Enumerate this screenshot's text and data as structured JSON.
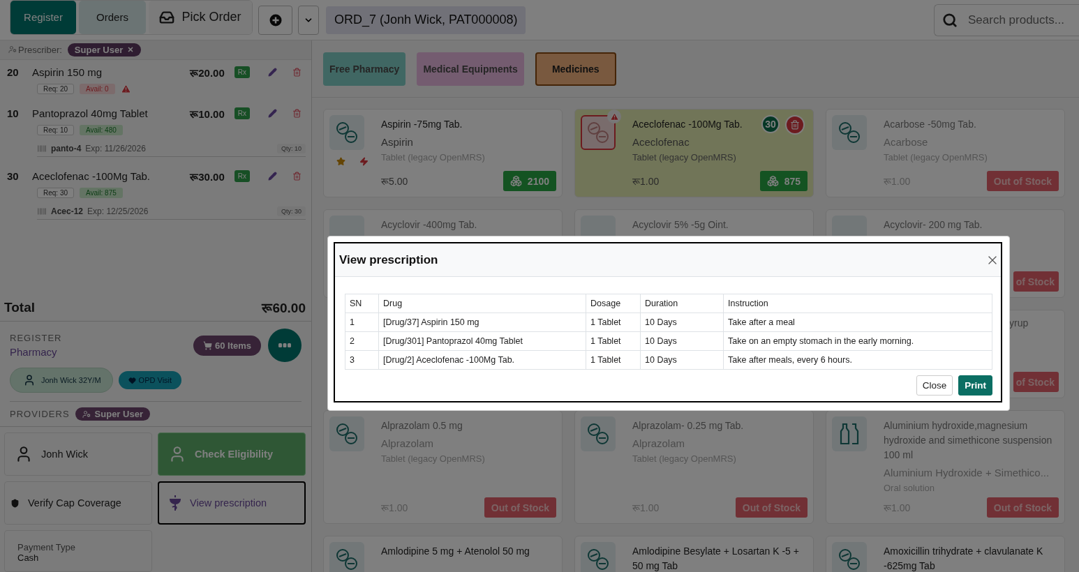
{
  "top_bar": {
    "tabs": [
      {
        "label": "Register",
        "selected": true
      },
      {
        "label": "Orders",
        "selected": false
      },
      {
        "label": "Pick Order",
        "selected": false
      }
    ],
    "order_label": "ORD_7 (Jonh Wick, PAT000008)",
    "search": {
      "placeholder": "Search products..."
    }
  },
  "cart": {
    "prescriber_label": "Prescriber:",
    "prescriber": "Super User",
    "items": [
      {
        "qty": "20",
        "name": "Aspirin 150 mg",
        "price": "रू20.00",
        "rx": "Rx",
        "req": "Req: 20",
        "avail": "Avail: 0",
        "available": false
      },
      {
        "qty": "10",
        "name": "Pantoprazol 40mg Tablet",
        "price": "रू10.00",
        "rx": "Rx",
        "req": "Req: 10",
        "avail": "Avail: 480",
        "available": true,
        "batch": "panto-4",
        "expiry": "Exp: 11/26/2026",
        "batch_qty": "Qty: 10"
      },
      {
        "qty": "30",
        "name": "Aceclofenac -100Mg Tab.",
        "price": "रू30.00",
        "rx": "Rx",
        "req": "Req: 30",
        "avail": "Avail: 875",
        "available": true,
        "batch": "Acec-12",
        "expiry": "Exp: 12/25/2026",
        "batch_qty": "Qty: 30"
      }
    ],
    "total_label": "Total",
    "total": "रू60.00"
  },
  "register": {
    "label": "REGISTER",
    "name": "Pharmacy",
    "items_badge": "60 Items",
    "patient": "Jonh Wick 32Y/M",
    "visit": "OPD Visit",
    "providers_label": "PROVIDERS",
    "provider": "Super User"
  },
  "actions": [
    {
      "kind": "patient",
      "label": "Jonh Wick",
      "focused": false
    },
    {
      "kind": "eligibility",
      "label": "Check Eligibility",
      "focused": false
    },
    {
      "kind": "cap",
      "label": "Verify Cap Coverage",
      "focused": false
    },
    {
      "kind": "prescription",
      "label": "View prescription",
      "focused": true
    }
  ],
  "payment": {
    "label": "Payment Type",
    "value": "Cash"
  },
  "categories": [
    {
      "label": "Free Pharmacy",
      "selected": false
    },
    {
      "label": "Medical Equipments",
      "selected": false
    },
    {
      "label": "Medicines",
      "selected": true
    }
  ],
  "products": [
    {
      "kind": "tablet",
      "name": "Aspirin -75mg Tab.",
      "generic": "Aspirin",
      "form": "Tablet (legacy OpenMRS)",
      "price": "रू5.00",
      "stock": "2100",
      "in_stock": true,
      "selected": false,
      "starred": true,
      "urgent": true
    },
    {
      "kind": "tablet",
      "name": "Aceclofenac -100Mg Tab.",
      "generic": "Aceclofenac",
      "form": "Tablet (legacy OpenMRS)",
      "price": "रू1.00",
      "stock": "875",
      "in_stock": true,
      "selected": true,
      "cart_qty": "30",
      "starred": false,
      "urgent": false
    },
    {
      "kind": "tablet",
      "name": "Acarbose -50mg Tab.",
      "generic": "Acarbose",
      "form": "Tablet (legacy OpenMRS)",
      "price": "रू1.00",
      "stock": "Out of Stock",
      "in_stock": false,
      "selected": false,
      "starred": false,
      "urgent": false
    },
    {
      "kind": "covered",
      "name": "Acyclovir -400mg Tab."
    },
    {
      "kind": "covered",
      "name": "Acyclovir 5% -5g Oint."
    },
    {
      "kind": "covered",
      "name": "Acyclovir- 200 mg Tab.",
      "stock": "of Stock"
    },
    {
      "kind": "hidden"
    },
    {
      "kind": "hidden"
    },
    {
      "kind": "covered_right",
      "name": "yrup",
      "stock": "of Stock"
    },
    {
      "kind": "tablet",
      "name": "Alprazolam 0.5 mg",
      "generic": "Alprazolam",
      "form": "Tablet (legacy OpenMRS)",
      "price": "रू1.00",
      "stock": "Out of Stock",
      "in_stock": false,
      "selected": false,
      "starred": false,
      "urgent": false
    },
    {
      "kind": "tablet",
      "name": "Alprazolam- 0.25 mg Tab.",
      "generic": "Alprazolam",
      "form": "Tablet (legacy OpenMRS)",
      "price": "रू1.00",
      "stock": "Out of Stock",
      "in_stock": false,
      "selected": false,
      "starred": false,
      "urgent": false
    },
    {
      "kind": "bottle",
      "name": "Aluminium hydroxide,magnesium hydroxide and simethicone suspension 100 ml",
      "generic": "Aluminium Hydroxide + Simethico...",
      "form": "Oral solution",
      "price": "रू1.00",
      "stock": "Out of Stock",
      "in_stock": false,
      "selected": false,
      "starred": false,
      "urgent": false
    },
    {
      "kind": "tablet",
      "name": "Amlodipine 5 mg + Atenolol 50 mg",
      "in_stock": true,
      "selected": false,
      "starred": false,
      "urgent": false
    },
    {
      "kind": "tablet",
      "name": "Amlodipine Besylate + Losartan K -5 + 50 mg Tab",
      "in_stock": true,
      "selected": false,
      "starred": false,
      "urgent": false
    },
    {
      "kind": "tablet",
      "name": "Amoxicillin trihydrate + clavulanate K -625mg Tab",
      "in_stock": true,
      "selected": false,
      "starred": false,
      "urgent": false
    }
  ],
  "modal": {
    "title": "View prescription",
    "columns": [
      "SN",
      "Drug",
      "Dosage",
      "Duration",
      "Instruction"
    ],
    "rows": [
      [
        "1",
        "[Drug/37] Aspirin 150 mg",
        "1 Tablet",
        "10 Days",
        "Take after a meal"
      ],
      [
        "2",
        "[Drug/301] Pantoprazol 40mg Tablet",
        "1 Tablet",
        "10 Days",
        "Take on an empty stomach in the early morning."
      ],
      [
        "3",
        "[Drug/2] Aceclofenac -100Mg Tab.",
        "1 Tablet",
        "10 Days",
        "Take after meals, every 6 hours."
      ]
    ],
    "buttons": [
      {
        "kind": "secondary",
        "label": "Close"
      },
      {
        "kind": "primary",
        "label": "Print"
      }
    ]
  }
}
